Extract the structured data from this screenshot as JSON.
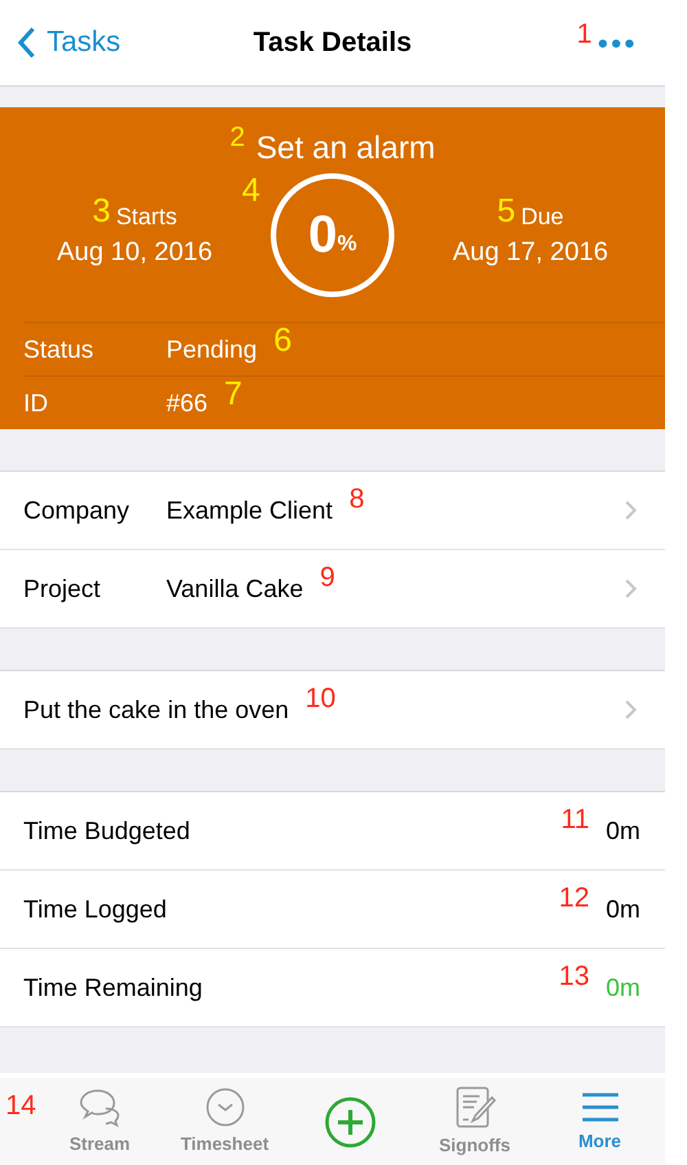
{
  "nav": {
    "back": "Tasks",
    "title": "Task Details",
    "menu": "•••",
    "marker": {
      "text": "1",
      "color": "#ff2a1a"
    }
  },
  "header": {
    "title": "Set an alarm",
    "title_marker": {
      "text": "2",
      "color": "#ffee00"
    },
    "starts": {
      "label": "Starts",
      "value": "Aug 10, 2016",
      "marker": {
        "text": "3",
        "color": "#ffee00"
      }
    },
    "progress": {
      "value": "0",
      "unit": "%",
      "marker": {
        "text": "4",
        "color": "#ffee00"
      }
    },
    "due": {
      "label": "Due",
      "value": "Aug 17, 2016",
      "marker": {
        "text": "5",
        "color": "#ffee00"
      }
    },
    "rows": [
      {
        "label": "Status",
        "value": "Pending",
        "marker": {
          "text": "6",
          "color": "#ffee00"
        }
      },
      {
        "label": "ID",
        "value": "#66",
        "marker": {
          "text": "7",
          "color": "#ffee00"
        }
      }
    ]
  },
  "groups": [
    [
      {
        "label": "Company",
        "value": "Example Client",
        "marker": {
          "text": "8",
          "color": "#ff2a1a"
        }
      },
      {
        "label": "Project",
        "value": "Vanilla Cake",
        "marker": {
          "text": "9",
          "color": "#ff2a1a"
        }
      }
    ],
    [
      {
        "value": "Put the cake in the oven",
        "marker": {
          "text": "10",
          "color": "#ff2a1a"
        }
      }
    ]
  ],
  "times": [
    {
      "label": "Time Budgeted",
      "value": "0m",
      "color": "#000000",
      "marker": {
        "text": "11",
        "color": "#ff2a1a"
      }
    },
    {
      "label": "Time Logged",
      "value": "0m",
      "color": "#000000",
      "marker": {
        "text": "12",
        "color": "#ff2a1a"
      }
    },
    {
      "label": "Time Remaining",
      "value": "0m",
      "color": "#3cc23c",
      "marker": {
        "text": "13",
        "color": "#ff2a1a"
      }
    }
  ],
  "tabbar": {
    "marker": {
      "text": "14",
      "color": "#ff2a1a"
    },
    "items": [
      {
        "kind": "stream",
        "label": "Stream",
        "selected": false
      },
      {
        "kind": "timesheet",
        "label": "Timesheet",
        "selected": false
      },
      {
        "kind": "add",
        "selected": false
      },
      {
        "kind": "signoffs",
        "label": "Signoffs",
        "selected": false
      },
      {
        "kind": "more",
        "label": "More",
        "selected": true
      }
    ]
  }
}
